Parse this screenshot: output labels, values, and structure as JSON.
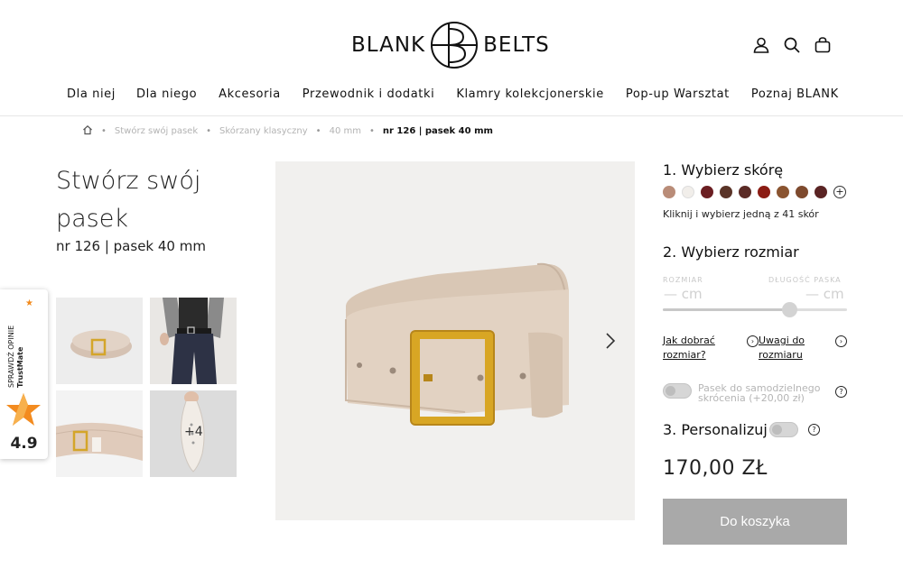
{
  "header": {
    "logo_left": "BLANK",
    "logo_right": "BELTS",
    "icons": [
      "account-icon",
      "search-icon",
      "cart-icon"
    ]
  },
  "nav": {
    "items": [
      "Dla niej",
      "Dla niego",
      "Akcesoria",
      "Przewodnik i dodatki",
      "Klamry kolekcjonerskie",
      "Pop-up Warsztat",
      "Poznaj BLANK"
    ]
  },
  "breadcrumb": {
    "home_icon": "home-icon",
    "items": [
      "Stwórz swój pasek",
      "Skórzany klasyczny",
      "40 mm"
    ],
    "current": "nr 126 | pasek 40 mm"
  },
  "product": {
    "title": "Stwórz swój pasek",
    "subtitle": "nr 126 | pasek 40 mm",
    "more_images": "+4",
    "price": "170,00 ZŁ",
    "cart_button": "Do koszyka"
  },
  "trustmate": {
    "label": "SPRAWDŹ OPINIE",
    "brand": "TrustMate",
    "rating": "4.9"
  },
  "config": {
    "step1": "1. Wybierz skórę",
    "swatches": [
      "#b98c78",
      "#f1eeea",
      "#6b1e22",
      "#5a3428",
      "#5b2b26",
      "#8b1c14",
      "#8a5430",
      "#7e4a2e",
      "#5a2424"
    ],
    "swatch_hint": "Kliknij i wybierz jedną z 41 skór",
    "step2": "2. Wybierz rozmiar",
    "size_label": "ROZMIAR",
    "size_value": "— cm",
    "length_label": "DŁUGOŚĆ PASKA",
    "length_value": "— cm",
    "link_size_guide": "Jak dobrać rozmiar?",
    "link_size_notes": "Uwagi do rozmiaru",
    "shorten_option": "Pasek do samodzielnego skrócenia (+20,00 zł)",
    "step3": "3. Personalizuj"
  }
}
